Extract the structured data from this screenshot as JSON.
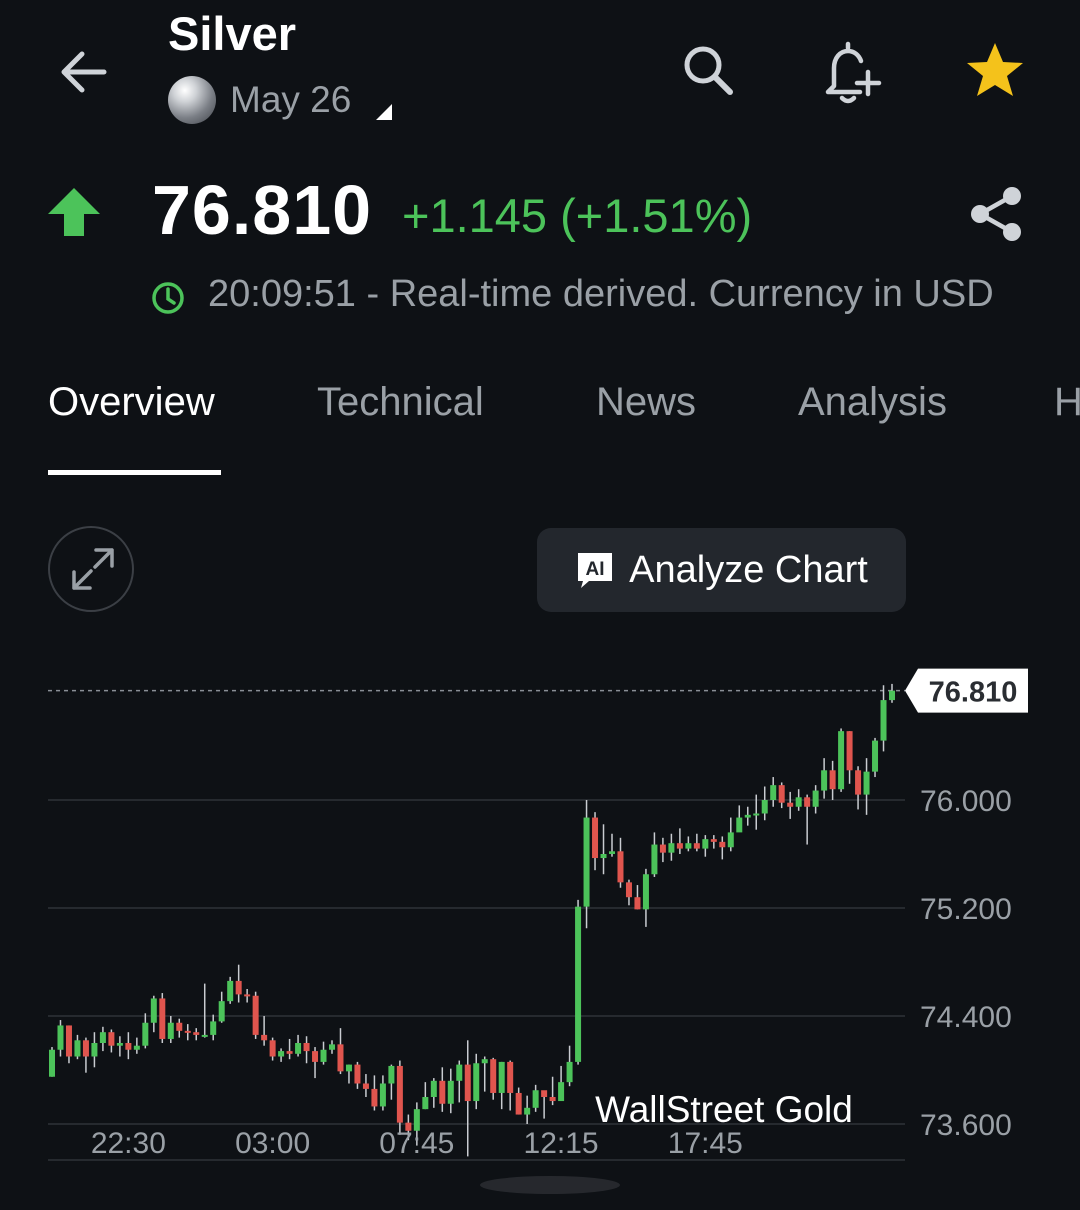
{
  "header": {
    "title": "Silver",
    "contract": "May 26"
  },
  "quote": {
    "price": "76.810",
    "change": "+1.145 (+1.51%)",
    "timestamp_text": "20:09:51 - Real-time derived. Currency in USD",
    "up_color": "#4cc35a"
  },
  "tabs": [
    {
      "label": "Overview",
      "active": true
    },
    {
      "label": "Technical",
      "active": false
    },
    {
      "label": "News",
      "active": false
    },
    {
      "label": "Analysis",
      "active": false
    },
    {
      "label": "H",
      "active": false
    }
  ],
  "analyze_button": {
    "badge": "AI",
    "label": "Analyze Chart"
  },
  "watermark": "WallStreet Gold",
  "icons": {
    "back": "arrow-left-icon",
    "search": "search-icon",
    "alert": "bell-plus-icon",
    "favorite": "star-icon",
    "share": "share-icon",
    "expand": "expand-icon",
    "clock": "clock-icon",
    "trend": "arrow-up-icon"
  },
  "colors": {
    "background": "#0e1115",
    "up": "#4cc35a",
    "down": "#e0554e",
    "star": "#f4c21b"
  },
  "chart_data": {
    "type": "candlestick",
    "current_price": 76.81,
    "current_price_label": "76.810",
    "y_ticks": [
      {
        "value": 76.0,
        "label": "76.000"
      },
      {
        "value": 75.2,
        "label": "75.200"
      },
      {
        "value": 74.4,
        "label": "74.400"
      },
      {
        "value": 73.6,
        "label": "73.600"
      }
    ],
    "ylim": [
      73.6,
      76.8
    ],
    "x_ticks": [
      "22:30",
      "03:00",
      "07:45",
      "12:15",
      "17:45"
    ],
    "x_tick_index": [
      9,
      26,
      43,
      60,
      77
    ],
    "candles": [
      [
        73.95,
        74.15,
        74.17,
        73.95
      ],
      [
        74.15,
        74.33,
        74.37,
        74.1
      ],
      [
        74.33,
        74.1,
        74.33,
        74.05
      ],
      [
        74.1,
        74.22,
        74.26,
        74.08
      ],
      [
        74.22,
        74.1,
        74.24,
        73.98
      ],
      [
        74.1,
        74.2,
        74.28,
        74.02
      ],
      [
        74.2,
        74.28,
        74.32,
        74.14
      ],
      [
        74.28,
        74.18,
        74.3,
        74.13
      ],
      [
        74.18,
        74.2,
        74.25,
        74.1
      ],
      [
        74.2,
        74.15,
        74.28,
        74.08
      ],
      [
        74.15,
        74.18,
        74.24,
        74.12
      ],
      [
        74.18,
        74.35,
        74.42,
        74.16
      ],
      [
        74.35,
        74.53,
        74.55,
        74.28
      ],
      [
        74.53,
        74.23,
        74.57,
        74.2
      ],
      [
        74.23,
        74.35,
        74.4,
        74.2
      ],
      [
        74.35,
        74.29,
        74.38,
        74.24
      ],
      [
        74.29,
        74.28,
        74.34,
        74.22
      ],
      [
        74.28,
        74.26,
        74.31,
        74.22
      ],
      [
        74.26,
        74.26,
        74.64,
        74.24
      ],
      [
        74.26,
        74.36,
        74.41,
        74.22
      ],
      [
        74.36,
        74.51,
        74.58,
        74.35
      ],
      [
        74.51,
        74.66,
        74.69,
        74.49
      ],
      [
        74.66,
        74.56,
        74.78,
        74.5
      ],
      [
        74.56,
        74.55,
        74.6,
        74.5
      ],
      [
        74.55,
        74.26,
        74.58,
        74.23
      ],
      [
        74.26,
        74.22,
        74.4,
        74.18
      ],
      [
        74.22,
        74.1,
        74.24,
        74.07
      ],
      [
        74.1,
        74.14,
        74.16,
        74.06
      ],
      [
        74.14,
        74.12,
        74.23,
        74.08
      ],
      [
        74.12,
        74.2,
        74.26,
        74.1
      ],
      [
        74.2,
        74.14,
        74.25,
        74.05
      ],
      [
        74.14,
        74.06,
        74.17,
        73.94
      ],
      [
        74.06,
        74.15,
        74.21,
        74.04
      ],
      [
        74.15,
        74.19,
        74.22,
        74.12
      ],
      [
        74.19,
        73.99,
        74.31,
        73.97
      ],
      [
        73.99,
        74.04,
        74.04,
        73.9
      ],
      [
        74.04,
        73.9,
        74.06,
        73.86
      ],
      [
        73.9,
        73.86,
        73.97,
        73.8
      ],
      [
        73.86,
        73.73,
        73.96,
        73.7
      ],
      [
        73.73,
        73.9,
        73.96,
        73.7
      ],
      [
        73.9,
        74.03,
        74.04,
        73.78
      ],
      [
        74.03,
        73.61,
        74.07,
        73.52
      ],
      [
        73.61,
        73.55,
        73.67,
        73.48
      ],
      [
        73.55,
        73.71,
        73.76,
        73.44
      ],
      [
        73.71,
        73.8,
        73.91,
        73.71
      ],
      [
        73.8,
        73.92,
        73.94,
        73.72
      ],
      [
        73.92,
        73.75,
        74.02,
        73.69
      ],
      [
        73.75,
        73.92,
        74.01,
        73.68
      ],
      [
        73.92,
        74.04,
        74.07,
        73.76
      ],
      [
        74.04,
        73.77,
        74.22,
        73.36
      ],
      [
        73.77,
        74.05,
        74.12,
        73.71
      ],
      [
        74.05,
        74.08,
        74.1,
        73.84
      ],
      [
        74.08,
        73.83,
        74.09,
        73.78
      ],
      [
        73.83,
        74.06,
        74.06,
        73.71
      ],
      [
        74.06,
        73.83,
        74.07,
        73.7
      ],
      [
        73.83,
        73.67,
        73.87,
        73.67
      ],
      [
        73.67,
        73.72,
        73.81,
        73.6
      ],
      [
        73.72,
        73.85,
        73.89,
        73.69
      ],
      [
        73.85,
        73.8,
        73.83,
        73.64
      ],
      [
        73.8,
        73.77,
        73.95,
        73.74
      ],
      [
        73.77,
        73.91,
        74.03,
        73.86
      ],
      [
        73.91,
        74.06,
        74.18,
        73.88
      ],
      [
        74.06,
        75.21,
        75.26,
        74.04
      ],
      [
        75.21,
        75.87,
        76.0,
        75.05
      ],
      [
        75.87,
        75.57,
        75.91,
        75.48
      ],
      [
        75.57,
        75.6,
        75.82,
        75.45
      ],
      [
        75.6,
        75.62,
        75.75,
        75.58
      ],
      [
        75.62,
        75.39,
        75.72,
        75.35
      ],
      [
        75.39,
        75.28,
        75.41,
        75.22
      ],
      [
        75.28,
        75.19,
        75.37,
        75.19
      ],
      [
        75.19,
        75.45,
        75.49,
        75.06
      ],
      [
        75.45,
        75.67,
        75.76,
        75.43
      ],
      [
        75.67,
        75.61,
        75.72,
        75.54
      ],
      [
        75.61,
        75.68,
        75.75,
        75.55
      ],
      [
        75.68,
        75.64,
        75.79,
        75.6
      ],
      [
        75.64,
        75.68,
        75.73,
        75.62
      ],
      [
        75.68,
        75.64,
        75.75,
        75.62
      ],
      [
        75.64,
        75.71,
        75.74,
        75.58
      ],
      [
        75.71,
        75.69,
        75.74,
        75.64
      ],
      [
        75.69,
        75.65,
        75.73,
        75.56
      ],
      [
        75.65,
        75.76,
        75.87,
        75.62
      ],
      [
        75.76,
        75.87,
        75.96,
        75.83
      ],
      [
        75.87,
        75.89,
        75.95,
        75.81
      ],
      [
        75.89,
        75.9,
        76.04,
        75.78
      ],
      [
        75.9,
        76.0,
        76.1,
        75.85
      ],
      [
        76.0,
        76.11,
        76.17,
        75.95
      ],
      [
        76.11,
        75.98,
        76.13,
        75.94
      ],
      [
        75.98,
        75.95,
        76.06,
        75.86
      ],
      [
        75.95,
        76.02,
        76.08,
        75.92
      ],
      [
        76.02,
        75.95,
        76.04,
        75.67
      ],
      [
        75.95,
        76.07,
        76.11,
        75.9
      ],
      [
        76.07,
        76.22,
        76.31,
        76.01
      ],
      [
        76.22,
        76.08,
        76.29,
        76.0
      ],
      [
        76.08,
        76.51,
        76.53,
        76.06
      ],
      [
        76.51,
        76.22,
        76.51,
        76.12
      ],
      [
        76.22,
        76.04,
        76.25,
        75.93
      ],
      [
        76.04,
        76.21,
        76.31,
        75.89
      ],
      [
        76.21,
        76.44,
        76.46,
        76.17
      ],
      [
        76.44,
        76.74,
        76.85,
        76.36
      ],
      [
        76.74,
        76.81,
        76.86,
        76.72
      ]
    ]
  }
}
